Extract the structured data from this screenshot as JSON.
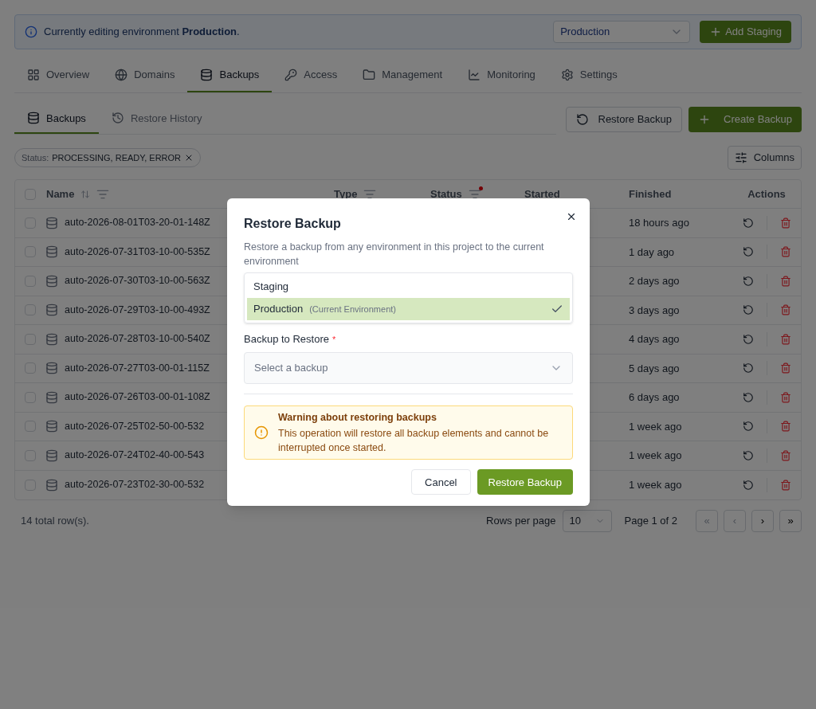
{
  "banner": {
    "text": "Currently editing environment **Production**.",
    "environment": "Production",
    "add_button": "Add Staging"
  },
  "tabs": [
    {
      "label": "Overview",
      "selected": false
    },
    {
      "label": "Domains",
      "selected": false
    },
    {
      "label": "Backups",
      "selected": true
    },
    {
      "label": "Access",
      "selected": false
    },
    {
      "label": "Management",
      "selected": false
    },
    {
      "label": "Monitoring",
      "selected": false
    },
    {
      "label": "Settings",
      "selected": false
    }
  ],
  "subtabs": [
    {
      "label": "Backups",
      "selected": true
    },
    {
      "label": "Restore History",
      "selected": false
    }
  ],
  "actions": {
    "restore": "Restore Backup",
    "create": "Create Backup"
  },
  "filter": {
    "label": "Status:",
    "value": "PROCESSING, READY, ERROR"
  },
  "columns_button": "Columns",
  "table": {
    "all_checked": false,
    "columns": [
      {
        "label": "Name",
        "kind": "sort_filter",
        "filtered": false
      },
      {
        "label": "Type",
        "kind": "filter",
        "filtered": false
      },
      {
        "label": "Status",
        "kind": "filter",
        "filtered": true
      },
      {
        "label": "Started",
        "kind": "plain"
      },
      {
        "label": "Finished",
        "kind": "plain"
      },
      {
        "label": "Actions",
        "kind": "plain"
      }
    ],
    "rows": [
      {
        "name": "auto-2026-08-01T03-20-01-148Z",
        "finished": "18 hours ago",
        "checked": false
      },
      {
        "name": "auto-2026-07-31T03-10-00-535Z",
        "finished": "1 day ago",
        "checked": false
      },
      {
        "name": "auto-2026-07-30T03-10-00-563Z",
        "finished": "2 days ago",
        "checked": false
      },
      {
        "name": "auto-2026-07-29T03-10-00-493Z",
        "finished": "3 days ago",
        "checked": false
      },
      {
        "name": "auto-2026-07-28T03-10-00-540Z",
        "finished": "4 days ago",
        "checked": false
      },
      {
        "name": "auto-2026-07-27T03-00-01-115Z",
        "finished": "5 days ago",
        "checked": false
      },
      {
        "name": "auto-2026-07-26T03-00-01-108Z",
        "finished": "6 days ago",
        "checked": false
      },
      {
        "name": "auto-2026-07-25T02-50-00-532",
        "finished": "1 week ago",
        "checked": false
      },
      {
        "name": "auto-2026-07-24T02-40-00-543",
        "finished": "1 week ago",
        "checked": false
      },
      {
        "name": "auto-2026-07-23T02-30-00-532",
        "finished": "1 week ago",
        "checked": false
      }
    ]
  },
  "footer": {
    "total": "14 total row(s).",
    "rows_per_page_label": "Rows per page",
    "rows_per_page": "10",
    "page": "Page 1 of 2",
    "first": "«",
    "prev": "‹",
    "next": "›",
    "last": "»"
  },
  "dialog": {
    "title": "Restore Backup",
    "description": "Restore a backup from any environment in this project to the current environment",
    "environments": [
      {
        "label": "Staging",
        "selected": false
      },
      {
        "label": "Production",
        "note": "(Current Environment)",
        "selected": true
      }
    ],
    "backup_label": "Backup to Restore",
    "required_mark": "*",
    "backup_placeholder": "Select a backup",
    "warning_title": "Warning about restoring backups",
    "warning_text": "This operation will restore all backup elements and cannot be interrupted once started.",
    "cancel": "Cancel",
    "confirm": "Restore Backup"
  }
}
